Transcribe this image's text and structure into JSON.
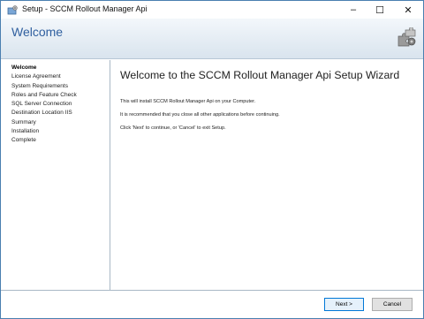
{
  "window": {
    "title": "Setup - SCCM Rollout Manager Api",
    "controls": {
      "minimize": "–",
      "maximize": "☐",
      "close": "✕"
    }
  },
  "banner": {
    "title": "Welcome",
    "icon": "puzzle-gear-icon"
  },
  "sidebar": {
    "items": [
      {
        "label": "Welcome",
        "active": true
      },
      {
        "label": "License Agreement",
        "active": false
      },
      {
        "label": "System Requirements",
        "active": false
      },
      {
        "label": "Roles and Feature Check",
        "active": false
      },
      {
        "label": "SQL Server Connection",
        "active": false
      },
      {
        "label": "Destination Location IIS",
        "active": false
      },
      {
        "label": "Summary",
        "active": false
      },
      {
        "label": "Installation",
        "active": false
      },
      {
        "label": "Complete",
        "active": false
      }
    ]
  },
  "main": {
    "heading": "Welcome to the SCCM Rollout Manager Api Setup Wizard",
    "lines": [
      "This will install SCCM Rollout Manager Api on your Computer.",
      "It is recommended that you close all other applications before continuing.",
      "Click 'Next' to continue, or 'Cancel' to exit Setup."
    ]
  },
  "footer": {
    "next_label": "Next >",
    "cancel_label": "Cancel"
  },
  "colors": {
    "accent": "#2f5f9f",
    "border": "#a9b8c6",
    "default_button_border": "#0078d7"
  }
}
